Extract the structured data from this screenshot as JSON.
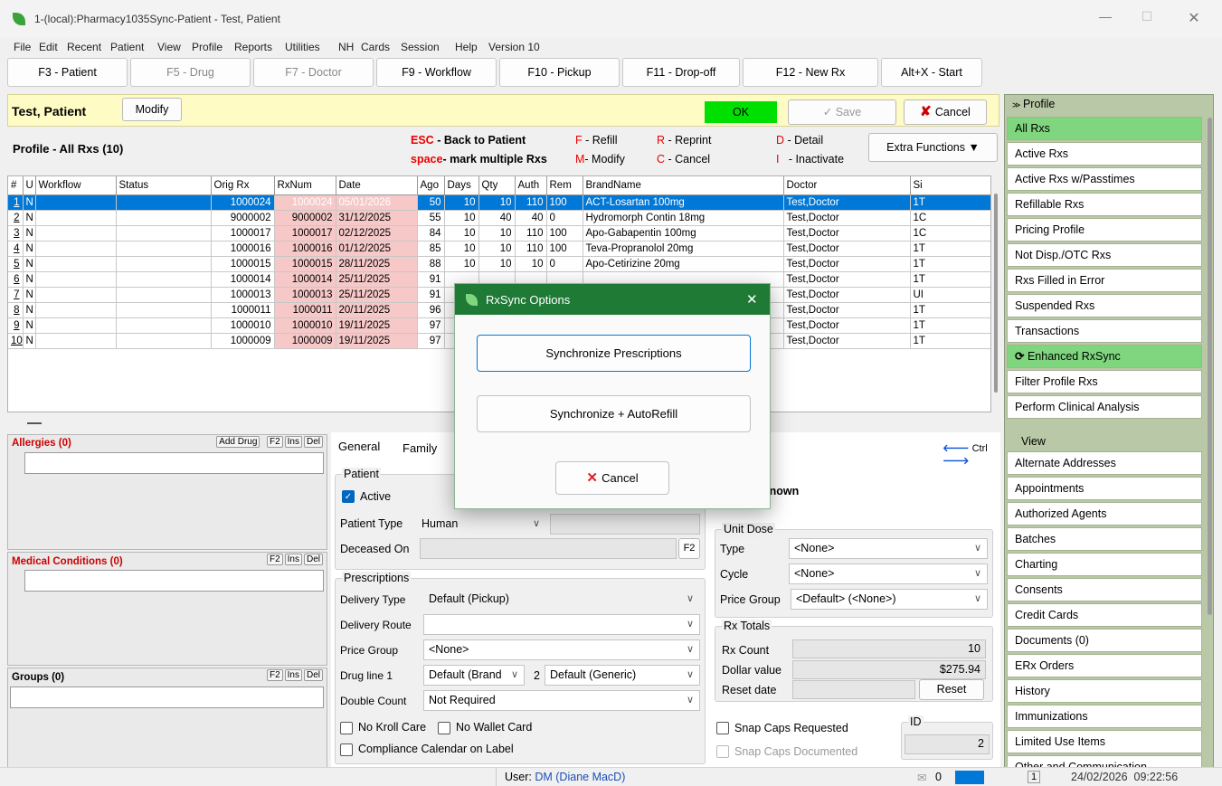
{
  "window": {
    "title": "1-(local):Pharmacy1035Sync-Patient - Test, Patient"
  },
  "menu": [
    "File",
    "Edit",
    "Recent",
    "Patient",
    "View",
    "Profile",
    "Reports",
    "Utilities",
    "NH",
    "Cards",
    "Session",
    "Help",
    "Version 10"
  ],
  "fkeys": [
    {
      "label": "F3 - Patient",
      "enabled": true
    },
    {
      "label": "F5 - Drug",
      "enabled": false
    },
    {
      "label": "F7 - Doctor",
      "enabled": false
    },
    {
      "label": "F9 - Workflow",
      "enabled": true
    },
    {
      "label": "F10 - Pickup",
      "enabled": true
    },
    {
      "label": "F11 - Drop-off",
      "enabled": true
    },
    {
      "label": "F12 - New Rx",
      "enabled": true
    },
    {
      "label": "Alt+X - Start",
      "enabled": true
    }
  ],
  "header": {
    "patient_name": "Test, Patient",
    "modify_label": "Modify",
    "ok_label": "OK",
    "save_label": "Save",
    "cancel_label": "Cancel"
  },
  "profile": {
    "title": "Profile - All Rxs (10)",
    "hints": {
      "esc_key": "ESC",
      "esc_text": "- Back to Patient",
      "space_key": "space",
      "space_text": "- mark multiple Rxs",
      "f_key": "F",
      "f_text": "- Refill",
      "m_key": "M",
      "m_text": "- Modify",
      "r_key": "R",
      "r_text": "- Reprint",
      "c_key": "C",
      "c_text": "- Cancel",
      "d_key": "D",
      "d_text": "- Detail",
      "i_key": "I",
      "i_text": "- Inactivate"
    },
    "extra_functions": "Extra Functions"
  },
  "grid": {
    "columns": [
      "#",
      "U",
      "Workflow",
      "Status",
      "Orig Rx",
      "RxNum",
      "Date",
      "Ago",
      "Days",
      "Qty",
      "Auth",
      "Rem",
      "BrandName",
      "Doctor",
      "Si"
    ],
    "rows": [
      [
        "1",
        "N",
        "",
        "",
        "1000024",
        "1000024",
        "05/01/2026",
        "50",
        "10",
        "10",
        "110",
        "100",
        "ACT-Losartan 100mg",
        "Test,Doctor",
        "1T"
      ],
      [
        "2",
        "N",
        "",
        "",
        "9000002",
        "9000002",
        "31/12/2025",
        "55",
        "10",
        "40",
        "40",
        "0",
        "Hydromorph Contin 18mg",
        "Test,Doctor",
        "1C"
      ],
      [
        "3",
        "N",
        "",
        "",
        "1000017",
        "1000017",
        "02/12/2025",
        "84",
        "10",
        "10",
        "110",
        "100",
        "Apo-Gabapentin 100mg",
        "Test,Doctor",
        "1C"
      ],
      [
        "4",
        "N",
        "",
        "",
        "1000016",
        "1000016",
        "01/12/2025",
        "85",
        "10",
        "10",
        "110",
        "100",
        "Teva-Propranolol 20mg",
        "Test,Doctor",
        "1T"
      ],
      [
        "5",
        "N",
        "",
        "",
        "1000015",
        "1000015",
        "28/11/2025",
        "88",
        "10",
        "10",
        "10",
        "0",
        "Apo-Cetirizine 20mg",
        "Test,Doctor",
        "1T"
      ],
      [
        "6",
        "N",
        "",
        "",
        "1000014",
        "1000014",
        "25/11/2025",
        "91",
        "",
        "",
        "",
        "",
        "",
        "Test,Doctor",
        "1T"
      ],
      [
        "7",
        "N",
        "",
        "",
        "1000013",
        "1000013",
        "25/11/2025",
        "91",
        "",
        "",
        "",
        "",
        "",
        "Test,Doctor",
        "UI"
      ],
      [
        "8",
        "N",
        "",
        "",
        "1000011",
        "1000011",
        "20/11/2025",
        "96",
        "",
        "",
        "",
        "",
        "",
        "Test,Doctor",
        "1T"
      ],
      [
        "9",
        "N",
        "",
        "",
        "1000010",
        "1000010",
        "19/11/2025",
        "97",
        "",
        "",
        "",
        "",
        "",
        "Test,Doctor",
        "1T"
      ],
      [
        "10",
        "N",
        "",
        "",
        "1000009",
        "1000009",
        "19/11/2025",
        "97",
        "",
        "",
        "",
        "",
        "",
        "Test,Doctor",
        "1T"
      ]
    ]
  },
  "side": {
    "profile_header": "Profile",
    "profile_items": [
      "All Rxs",
      "Active Rxs",
      "Active Rxs w/Passtimes",
      "Refillable Rxs",
      "Pricing Profile",
      "Not Disp./OTC Rxs",
      "Rxs Filled in Error",
      "Suspended Rxs",
      "Transactions",
      "Enhanced RxSync",
      "Filter Profile Rxs",
      "Perform Clinical Analysis"
    ],
    "view_header": "View",
    "view_items": [
      "Alternate Addresses",
      "Appointments",
      "Authorized Agents",
      "Batches",
      "Charting",
      "Consents",
      "Credit Cards",
      "Documents (0)",
      "ERx Orders",
      "History",
      "Immunizations",
      "Limited Use Items",
      "Other and Communication"
    ]
  },
  "left": {
    "allergies": "Allergies (0)",
    "add_drug": "Add Drug",
    "f2": "F2",
    "ins": "Ins",
    "del": "Del",
    "medical": "Medical Conditions (0)",
    "groups": "Groups (0)"
  },
  "tabs": {
    "general": "General",
    "family": "Family",
    "ctrl": "Ctrl"
  },
  "patient": {
    "group": "Patient",
    "active_label": "Active",
    "type_label": "Patient Type",
    "type_value": "Human",
    "deceased_label": "Deceased On",
    "f2": "F2",
    "status_tail": "nknown"
  },
  "prescriptions": {
    "group": "Prescriptions",
    "delivery_type_label": "Delivery Type",
    "delivery_type_value": "Default (Pickup)",
    "delivery_route_label": "Delivery Route",
    "delivery_route_value": "",
    "price_group_label": "Price Group",
    "price_group_value": "<None>",
    "drug_line_label": "Drug line 1",
    "drug_line_1": "Default (Brand",
    "drug_line_2_num": "2",
    "drug_line_2": "Default (Generic)",
    "double_count_label": "Double Count",
    "double_count_value": "Not Required",
    "no_kroll_care": "No Kroll Care",
    "no_wallet_card": "No Wallet Card",
    "compliance_calendar": "Compliance Calendar on Label"
  },
  "unit_dose": {
    "group": "Unit Dose",
    "type_label": "Type",
    "type_value": "<None>",
    "cycle_label": "Cycle",
    "cycle_value": "<None>",
    "price_group_label": "Price Group",
    "price_group_value": "<Default> (<None>)"
  },
  "rx_totals": {
    "group": "Rx Totals",
    "count_label": "Rx Count",
    "count_value": "10",
    "dollar_label": "Dollar value",
    "dollar_value": "$275.94",
    "reset_label": "Reset date",
    "reset_button": "Reset"
  },
  "snap": {
    "requested": "Snap Caps Requested",
    "documented": "Snap Caps Documented",
    "id_label": "ID",
    "id_value": "2"
  },
  "status": {
    "user_label": "User:",
    "user_value": "DM (Diane MacD)",
    "mail_count": "0",
    "page": "1",
    "datetime": "24/02/2026  09:22:56"
  },
  "dialog": {
    "title": "RxSync Options",
    "sync_label": "Synchronize Prescriptions",
    "sync_refill_label": "Synchronize + AutoRefill",
    "cancel_label": "Cancel"
  },
  "colors": {
    "accent_green": "#00e000",
    "dialog_title": "#1f7a36",
    "selection": "#0078d7",
    "pink": "#f6c8c8",
    "yellow_bar": "#fffbc4"
  }
}
